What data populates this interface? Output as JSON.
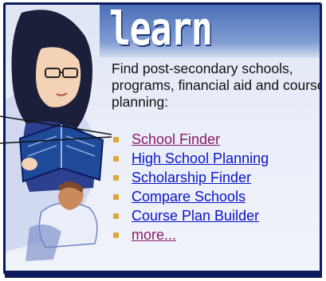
{
  "header": {
    "title": "learn"
  },
  "intro": {
    "text": "Find post-secondary schools, programs, financial aid and course planning:"
  },
  "links": [
    {
      "label": "School Finder",
      "visited": true
    },
    {
      "label": "High School Planning",
      "visited": false
    },
    {
      "label": "Scholarship Finder",
      "visited": false
    },
    {
      "label": "Compare Schools",
      "visited": false
    },
    {
      "label": "Course Plan Builder",
      "visited": false
    },
    {
      "label": "more...",
      "visited": true
    }
  ],
  "colors": {
    "border": "#0d1a5c",
    "link": "#0a14c8",
    "visited_link": "#8a1a6a",
    "bullet": "#e0a63a",
    "title_banner": "#4a6fb8"
  },
  "icons": {
    "bullet": "square-bullet-icon",
    "illustration": "student-reading-book-illustration"
  }
}
